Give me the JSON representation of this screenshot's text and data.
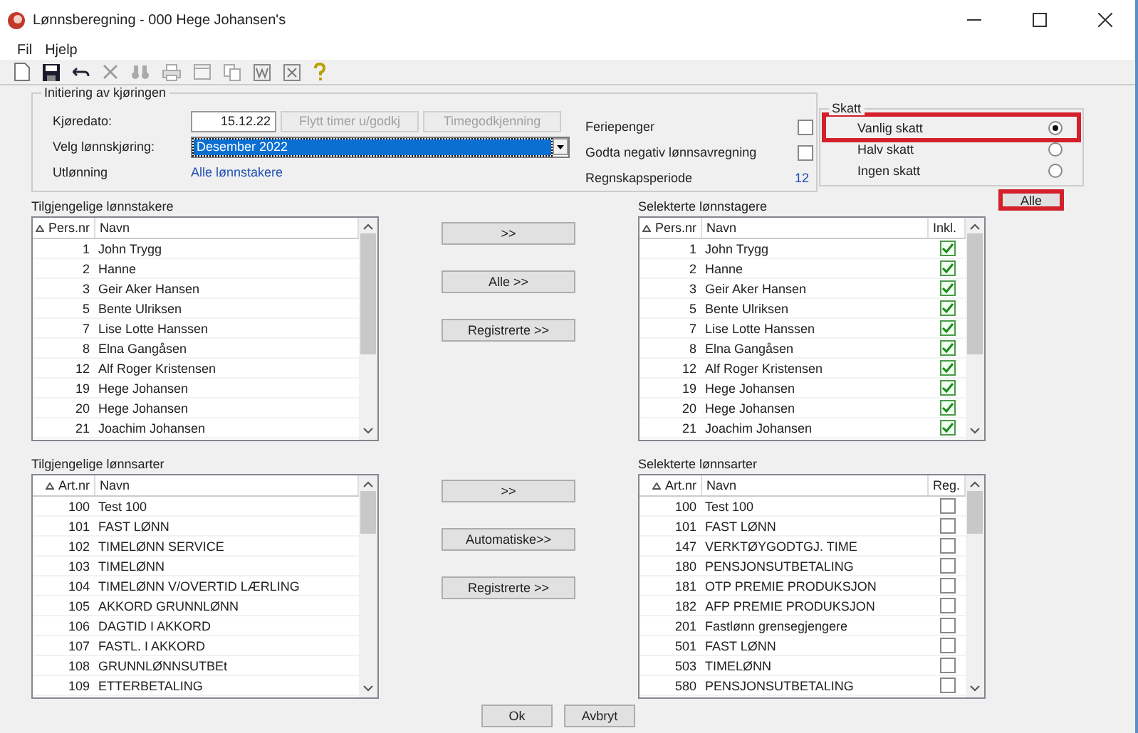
{
  "window": {
    "title": "Lønnsberegning - 000 Hege Johansen's"
  },
  "menu": [
    "Fil",
    "Hjelp"
  ],
  "init": {
    "title": "Initiering av kjøringen",
    "date_label": "Kjøredato:",
    "date_value": "15.12.22",
    "buttons": [
      {
        "label": "Flytt timer u/godkj",
        "disabled": true
      },
      {
        "label": "Timegodkjenning",
        "disabled": true
      }
    ],
    "run_label": "Velg lønnskjøring:",
    "run_value": "Desember 2022",
    "payout_label": "Utlønning",
    "payout_value": "Alle lønnstakere",
    "options": [
      {
        "kind": "checkbox",
        "label": "Feriepenger",
        "checked": false
      },
      {
        "kind": "checkbox",
        "label": "Godta negativ lønnsavregning",
        "checked": false
      },
      {
        "kind": "value",
        "label": "Regnskapsperiode",
        "value": "12"
      }
    ]
  },
  "tax": {
    "title": "Skatt",
    "options": [
      {
        "label": "Vanlig skatt",
        "selected": true,
        "highlighted": true
      },
      {
        "label": "Halv skatt",
        "selected": false,
        "highlighted": false
      },
      {
        "label": "Ingen skatt",
        "selected": false,
        "highlighted": false
      }
    ]
  },
  "all_button": {
    "label": "Alle",
    "highlighted": true
  },
  "sections": [
    {
      "left": {
        "title": "Tilgjengelige lønnstakere",
        "columns": [
          "Pers.nr",
          "Navn"
        ],
        "rows": [
          {
            "nr": "1",
            "name": "John Trygg"
          },
          {
            "nr": "2",
            "name": "Hanne"
          },
          {
            "nr": "3",
            "name": "Geir Aker Hansen"
          },
          {
            "nr": "5",
            "name": "Bente Ulriksen"
          },
          {
            "nr": "7",
            "name": "Lise Lotte Hanssen"
          },
          {
            "nr": "8",
            "name": "Elna Gangåsen"
          },
          {
            "nr": "12",
            "name": "Alf Roger Kristensen"
          },
          {
            "nr": "19",
            "name": "Hege Johansen"
          },
          {
            "nr": "20",
            "name": "Hege Johansen"
          },
          {
            "nr": "21",
            "name": "Joachim Johansen"
          }
        ]
      },
      "buttons": [
        ">>",
        "Alle >>",
        "Registrerte >>"
      ],
      "right": {
        "title": "Selekterte lønnstagere",
        "columns": [
          "Pers.nr",
          "Navn",
          "Inkl."
        ],
        "rows": [
          {
            "nr": "1",
            "name": "John Trygg",
            "checked": true
          },
          {
            "nr": "2",
            "name": "Hanne",
            "checked": true
          },
          {
            "nr": "3",
            "name": "Geir Aker Hansen",
            "checked": true
          },
          {
            "nr": "5",
            "name": "Bente Ulriksen",
            "checked": true
          },
          {
            "nr": "7",
            "name": "Lise Lotte Hanssen",
            "checked": true
          },
          {
            "nr": "8",
            "name": "Elna Gangåsen",
            "checked": true
          },
          {
            "nr": "12",
            "name": "Alf Roger Kristensen",
            "checked": true
          },
          {
            "nr": "19",
            "name": "Hege Johansen",
            "checked": true
          },
          {
            "nr": "20",
            "name": "Hege Johansen",
            "checked": true
          },
          {
            "nr": "21",
            "name": "Joachim Johansen",
            "checked": true
          }
        ]
      }
    },
    {
      "left": {
        "title": "Tilgjengelige lønnsarter",
        "columns": [
          "Art.nr",
          "Navn"
        ],
        "rows": [
          {
            "nr": "100",
            "name": "Test 100"
          },
          {
            "nr": "101",
            "name": "FAST LØNN"
          },
          {
            "nr": "102",
            "name": "TIMELØNN SERVICE"
          },
          {
            "nr": "103",
            "name": "TIMELØNN"
          },
          {
            "nr": "104",
            "name": "TIMELØNN V/OVERTID LÆRLING"
          },
          {
            "nr": "105",
            "name": "AKKORD GRUNNLØNN"
          },
          {
            "nr": "106",
            "name": "DAGTID I AKKORD"
          },
          {
            "nr": "107",
            "name": "FASTL. I AKKORD"
          },
          {
            "nr": "108",
            "name": "GRUNNLØNNSUTBEt"
          },
          {
            "nr": "109",
            "name": "ETTERBETALING"
          }
        ]
      },
      "buttons": [
        ">>",
        "Automatiske>>",
        "Registrerte >>"
      ],
      "right": {
        "title": "Selekterte lønnsarter",
        "columns": [
          "Art.nr",
          "Navn",
          "Reg."
        ],
        "rows": [
          {
            "nr": "100",
            "name": "Test 100",
            "checked": false
          },
          {
            "nr": "101",
            "name": "FAST LØNN",
            "checked": false
          },
          {
            "nr": "147",
            "name": "VERKTØYGODTGJ. TIME",
            "checked": false
          },
          {
            "nr": "180",
            "name": "PENSJONSUTBETALING",
            "checked": false
          },
          {
            "nr": "181",
            "name": "OTP PREMIE PRODUKSJON",
            "checked": false
          },
          {
            "nr": "182",
            "name": "AFP PREMIE PRODUKSJON",
            "checked": false
          },
          {
            "nr": "201",
            "name": "Fastlønn grensegjengere",
            "checked": false
          },
          {
            "nr": "501",
            "name": "FAST LØNN",
            "checked": false
          },
          {
            "nr": "503",
            "name": "TIMELØNN",
            "checked": false
          },
          {
            "nr": "580",
            "name": "PENSJONSUTBETALING",
            "checked": false
          }
        ]
      }
    }
  ],
  "footer_buttons": [
    "Ok",
    "Avbryt"
  ]
}
